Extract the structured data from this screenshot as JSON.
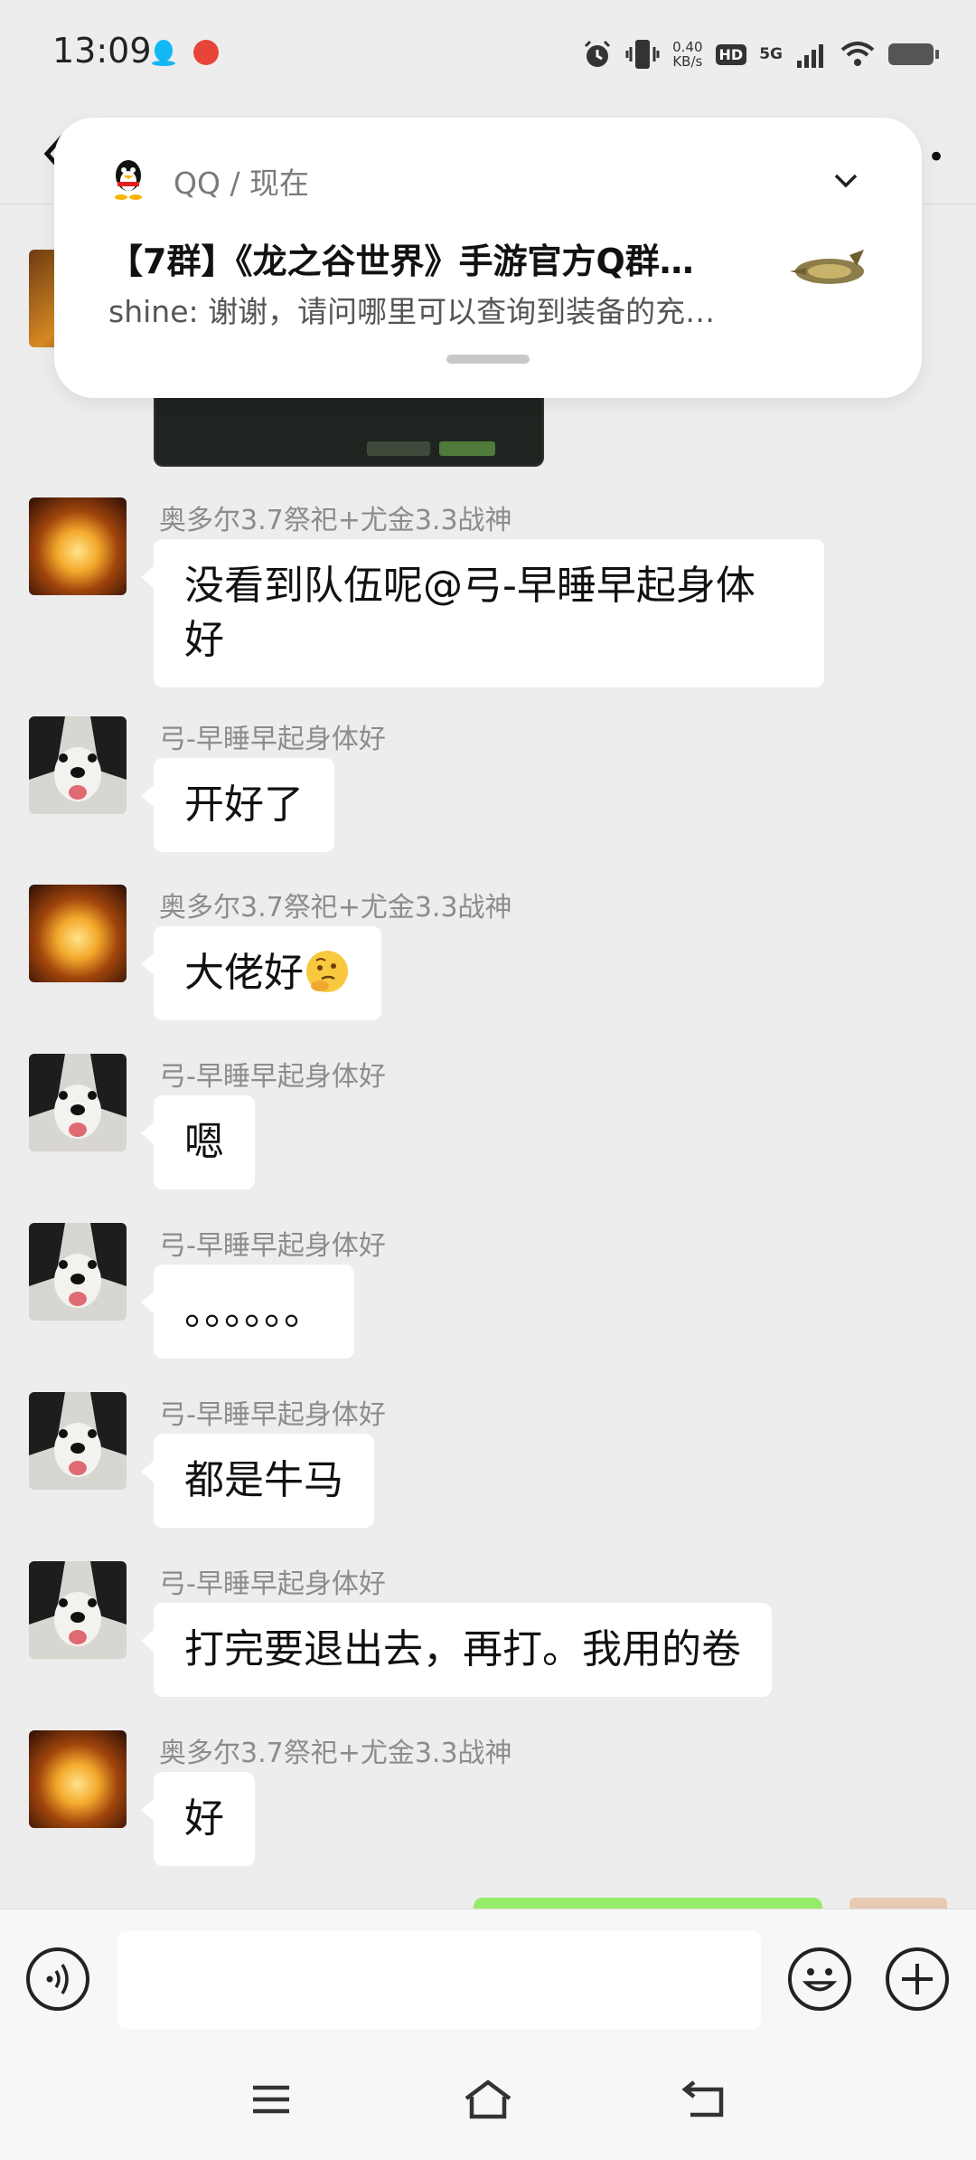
{
  "status_bar": {
    "time": "13:09",
    "net_speed_value": "0.40",
    "net_speed_unit": "KB/s",
    "hd_label": "HD",
    "network_label": "5G"
  },
  "notification": {
    "app_name": "QQ / 现在",
    "title": "【7群】《龙之谷世界》手游官方Q群…",
    "body": "shine: 谢谢，请问哪里可以查询到装备的充…"
  },
  "messages": [
    {
      "sender": "奥多尔3.7祭祀+尤金3.3战神",
      "text": "没看到队伍呢@弓-早睡早起身体好",
      "avatar": "warrior-avatar"
    },
    {
      "sender": "弓-早睡早起身体好",
      "text": "开好了",
      "avatar": "dog-avatar"
    },
    {
      "sender": "奥多尔3.7祭祀+尤金3.3战神",
      "text": "大佬好",
      "avatar": "warrior-avatar",
      "emoji": "thinking-face-emoji"
    },
    {
      "sender": "弓-早睡早起身体好",
      "text": "嗯",
      "avatar": "dog-avatar"
    },
    {
      "sender": "弓-早睡早起身体好",
      "text": "。。。。。。",
      "avatar": "dog-avatar"
    },
    {
      "sender": "弓-早睡早起身体好",
      "text": "都是牛马",
      "avatar": "dog-avatar"
    },
    {
      "sender": "弓-早睡早起身体好",
      "text": "打完要退出去，再打。我用的卷",
      "avatar": "dog-avatar"
    },
    {
      "sender": "奥多尔3.7祭祀+尤金3.3战神",
      "text": "好",
      "avatar": "warrior-avatar"
    }
  ],
  "input": {
    "value": "",
    "placeholder": ""
  },
  "icons": {
    "voice": "voice-icon",
    "emoji": "emoji-icon",
    "plus": "plus-icon",
    "menu": "menu-icon",
    "home": "home-icon",
    "back": "back-icon"
  },
  "colors": {
    "background": "#ededed",
    "bubble_incoming": "#ffffff",
    "bubble_outgoing": "#95ec69"
  }
}
